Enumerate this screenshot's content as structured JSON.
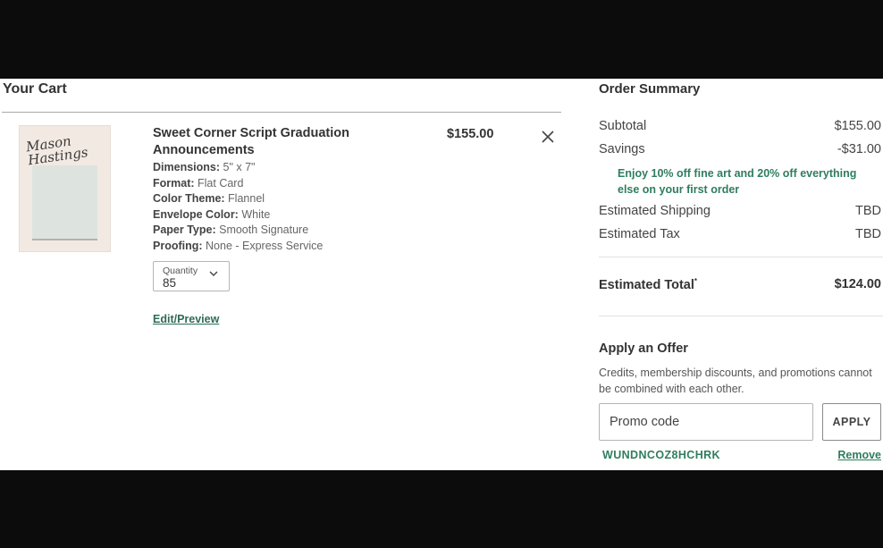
{
  "cart": {
    "title": "Your Cart",
    "item": {
      "thumbnail_script": "Mason Hastings",
      "name": "Sweet Corner Script Graduation Announcements",
      "price": "$155.00",
      "attributes": [
        {
          "key": "Dimensions:",
          "value": "5\" x 7\""
        },
        {
          "key": "Format:",
          "value": "Flat Card"
        },
        {
          "key": "Color Theme:",
          "value": "Flannel"
        },
        {
          "key": "Envelope Color:",
          "value": "White"
        },
        {
          "key": "Paper Type:",
          "value": "Smooth Signature"
        },
        {
          "key": "Proofing:",
          "value": "None - Express Service"
        }
      ],
      "quantity": {
        "label": "Quantity",
        "value": "85"
      },
      "edit_label": "Edit/Preview",
      "remove_icon": "close-icon"
    }
  },
  "summary": {
    "title": "Order Summary",
    "subtotal": {
      "label": "Subtotal",
      "value": "$155.00"
    },
    "savings": {
      "label": "Savings",
      "value": "-$31.00"
    },
    "promo_message": "Enjoy 10% off fine art and 20% off everything else on your first order",
    "shipping": {
      "label": "Estimated Shipping",
      "value": "TBD"
    },
    "tax": {
      "label": "Estimated Tax",
      "value": "TBD"
    },
    "total": {
      "label": "Estimated Total",
      "marker": "*",
      "value": "$124.00"
    }
  },
  "offer": {
    "title": "Apply an Offer",
    "note": "Credits, membership discounts, and promotions cannot be combined with each other.",
    "input_placeholder": "Promo code",
    "apply_label": "APPLY",
    "applied_code": "WUNDNCOZ8HCHRK",
    "remove_label": "Remove"
  },
  "colors": {
    "accent_green": "#2f7d5f",
    "link_green": "#2f6b56",
    "background_bar": "#0c0c0c"
  }
}
